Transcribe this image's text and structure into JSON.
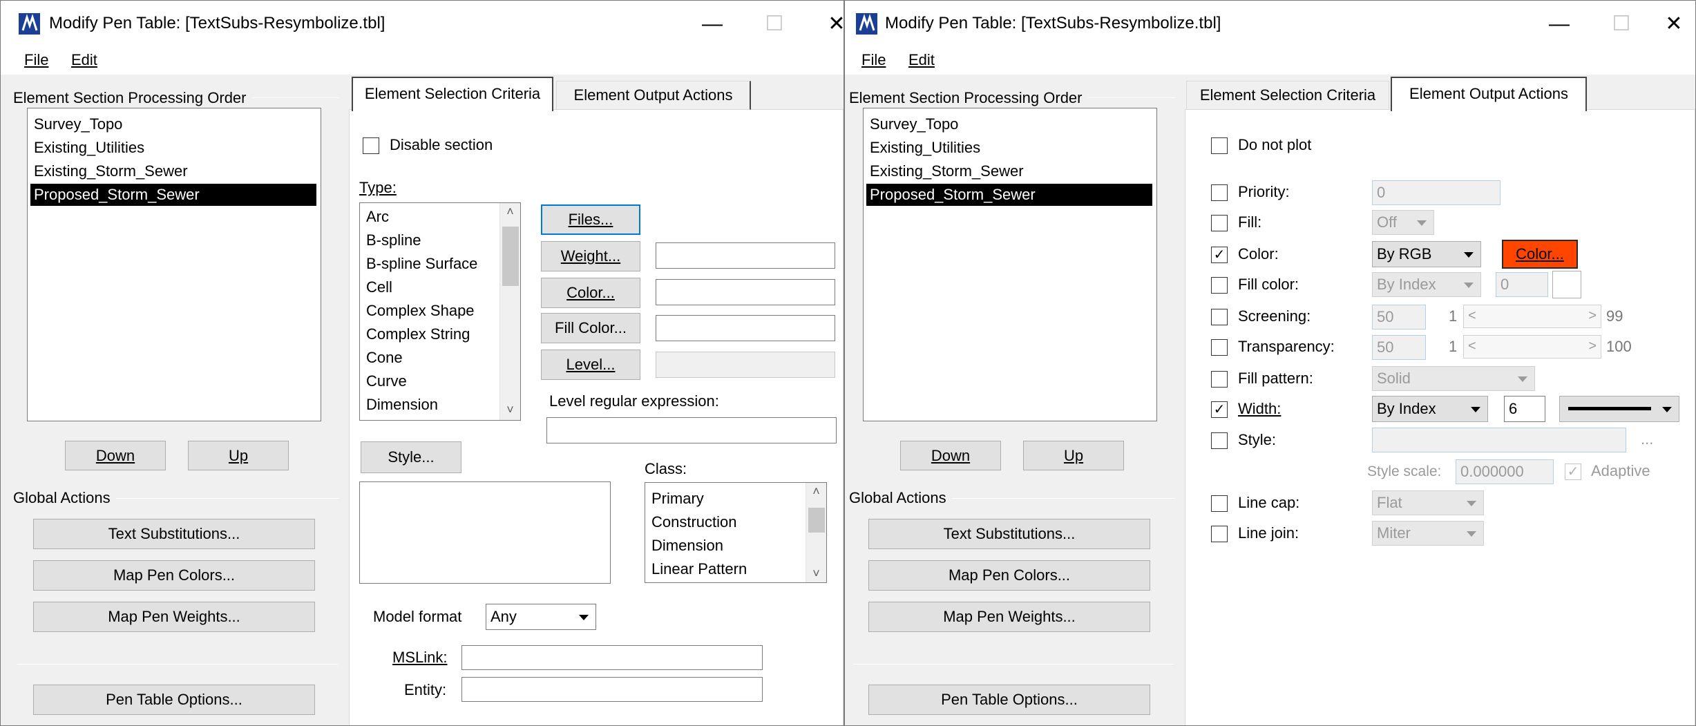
{
  "window_left": {
    "title": "Modify Pen Table: [TextSubs-Resymbolize.tbl]",
    "menu": {
      "file": "File",
      "edit": "Edit"
    },
    "processing_order_label": "Element Section Processing Order",
    "sections": [
      "Survey_Topo",
      "Existing_Utilities",
      "Existing_Storm_Sewer",
      "Proposed_Storm_Sewer"
    ],
    "selected_section": "Proposed_Storm_Sewer",
    "down_label": "Down",
    "up_label": "Up",
    "global_actions_label": "Global Actions",
    "text_subs_label": "Text Substitutions...",
    "map_colors_label": "Map Pen Colors...",
    "map_weights_label": "Map Pen Weights...",
    "pen_options_label": "Pen Table Options...",
    "tabs": {
      "criteria": "Element Selection Criteria",
      "output": "Element Output Actions"
    },
    "criteria": {
      "disable_section": "Disable section",
      "type_label": "Type:",
      "types": [
        "Arc",
        "B-spline",
        "B-spline Surface",
        "Cell",
        "Complex Shape",
        "Complex String",
        "Cone",
        "Curve",
        "Dimension"
      ],
      "files_btn": "Files...",
      "weight_btn": "Weight...",
      "color_btn": "Color...",
      "fill_color_btn": "Fill Color...",
      "level_btn": "Level...",
      "level_regex_label": "Level regular expression:",
      "style_btn": "Style...",
      "class_label": "Class:",
      "classes": [
        "Primary",
        "Construction",
        "Dimension",
        "Linear Pattern"
      ],
      "model_format_label": "Model format",
      "model_format_value": "Any",
      "mslink_label": "MSLink:",
      "entity_label": "Entity:"
    }
  },
  "window_right": {
    "title": "Modify Pen Table: [TextSubs-Resymbolize.tbl]",
    "menu": {
      "file": "File",
      "edit": "Edit"
    },
    "processing_order_label": "Element Section Processing Order",
    "sections": [
      "Survey_Topo",
      "Existing_Utilities",
      "Existing_Storm_Sewer",
      "Proposed_Storm_Sewer"
    ],
    "selected_section": "Proposed_Storm_Sewer",
    "down_label": "Down",
    "up_label": "Up",
    "global_actions_label": "Global Actions",
    "text_subs_label": "Text Substitutions...",
    "map_colors_label": "Map Pen Colors...",
    "map_weights_label": "Map Pen Weights...",
    "pen_options_label": "Pen Table Options...",
    "tabs": {
      "criteria": "Element Selection Criteria",
      "output": "Element Output Actions"
    },
    "output": {
      "do_not_plot": "Do not plot",
      "priority_label": "Priority:",
      "priority_value": "0",
      "fill_label": "Fill:",
      "fill_value": "Off",
      "color_label": "Color:",
      "color_value": "By RGB",
      "color_btn": "Color...",
      "color_swatch": "#ff4500",
      "fill_color_label": "Fill color:",
      "fill_color_value": "By Index",
      "fill_color_index": "0",
      "screening_label": "Screening:",
      "screening_value": "50",
      "screening_min": "1",
      "screening_max": "99",
      "transparency_label": "Transparency:",
      "transparency_value": "50",
      "transparency_min": "1",
      "transparency_max": "100",
      "fill_pattern_label": "Fill pattern:",
      "fill_pattern_value": "Solid",
      "width_label": "Width:",
      "width_value": "By Index",
      "width_number": "6",
      "style_label": "Style:",
      "style_more": "...",
      "style_scale_label": "Style scale:",
      "style_scale_value": "0.000000",
      "adaptive_label": "Adaptive",
      "line_cap_label": "Line cap:",
      "line_cap_value": "Flat",
      "line_join_label": "Line join:",
      "line_join_value": "Miter",
      "checked": {
        "color": true,
        "width": true
      }
    }
  },
  "glyphs": {
    "minimize": "—",
    "maximize": "☐",
    "close": "✕",
    "check": "✓",
    "scroll_up": "˄",
    "scroll_down": "˅",
    "slider_left": "<",
    "slider_right": ">"
  },
  "colors": {
    "accent_blue": "#0078d7",
    "selection": "#000000",
    "color_swatch": "#ff4500"
  }
}
